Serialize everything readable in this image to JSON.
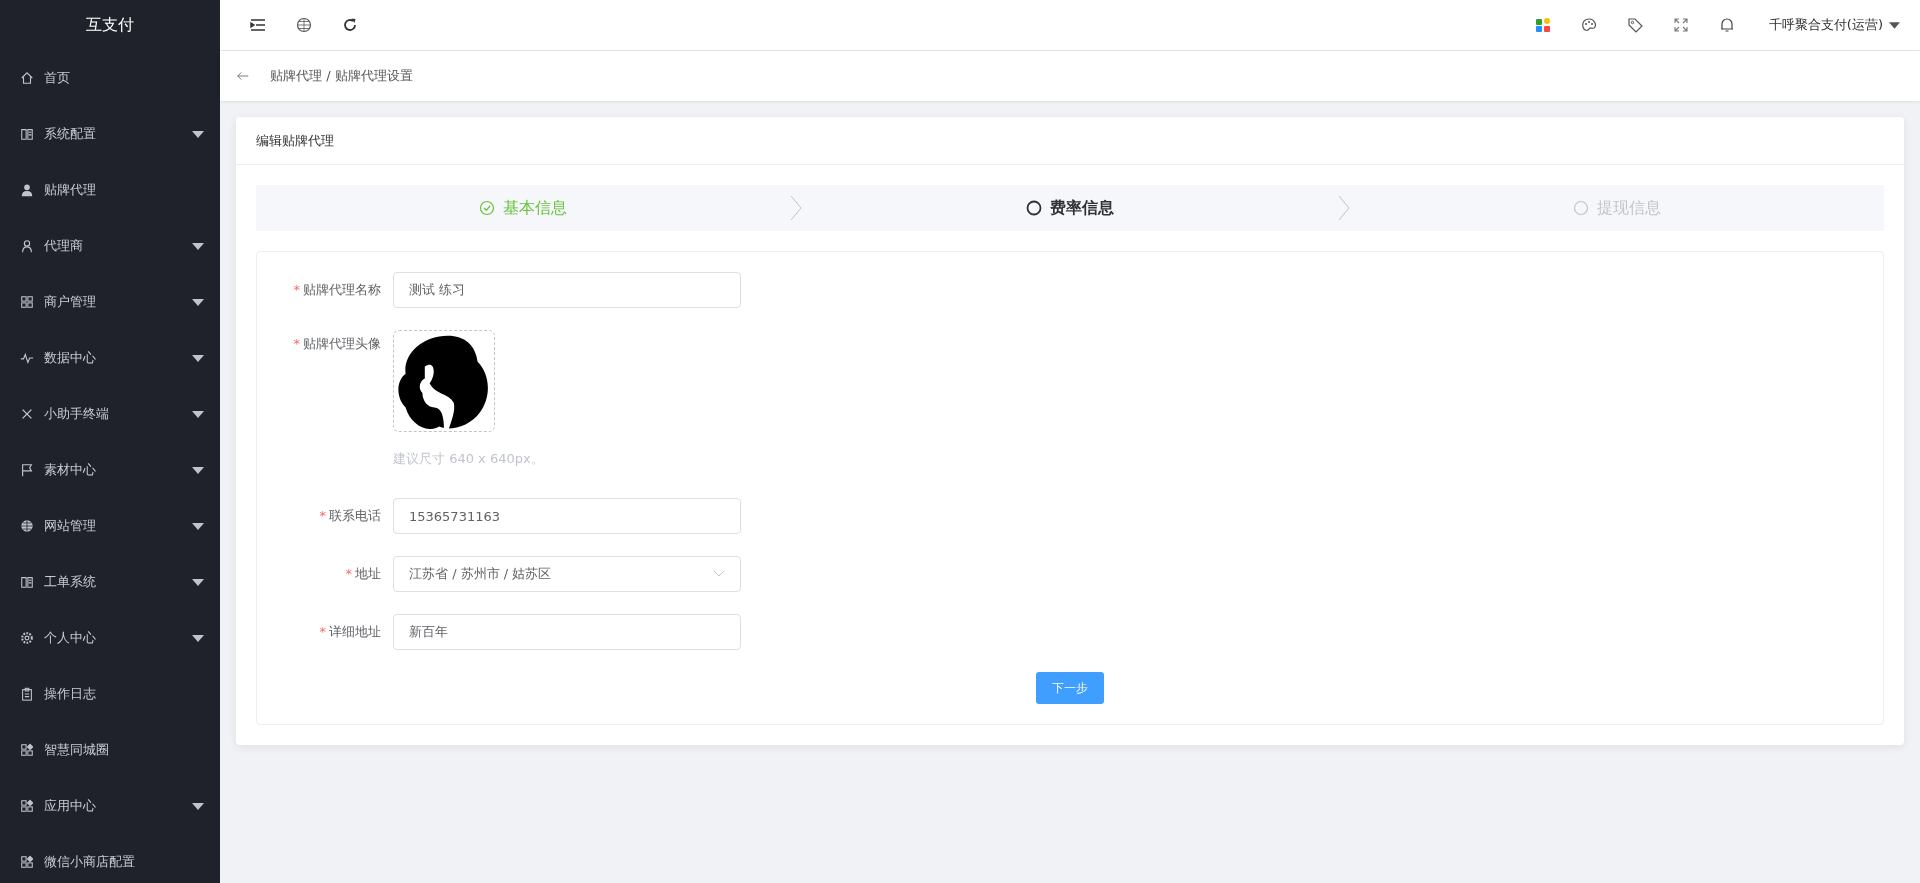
{
  "sidebar": {
    "logo": "互支付",
    "items": [
      {
        "label": "首页",
        "has_submenu": false
      },
      {
        "label": "系统配置",
        "has_submenu": true
      },
      {
        "label": "贴牌代理",
        "has_submenu": false
      },
      {
        "label": "代理商",
        "has_submenu": true
      },
      {
        "label": "商户管理",
        "has_submenu": true
      },
      {
        "label": "数据中心",
        "has_submenu": true
      },
      {
        "label": "小助手终端",
        "has_submenu": true
      },
      {
        "label": "素材中心",
        "has_submenu": true
      },
      {
        "label": "网站管理",
        "has_submenu": true
      },
      {
        "label": "工单系统",
        "has_submenu": true
      },
      {
        "label": "个人中心",
        "has_submenu": true
      },
      {
        "label": "操作日志",
        "has_submenu": false
      },
      {
        "label": "智慧同城圈",
        "has_submenu": false
      },
      {
        "label": "应用中心",
        "has_submenu": true
      },
      {
        "label": "微信小商店配置",
        "has_submenu": false
      }
    ]
  },
  "topbar": {
    "user": "千呼聚合支付(运营)"
  },
  "breadcrumb": "贴牌代理 / 贴牌代理设置",
  "card": {
    "title": "编辑贴牌代理",
    "steps": [
      {
        "label": "基本信息",
        "done": true,
        "selected": false
      },
      {
        "label": "费率信息",
        "done": false,
        "selected": true
      },
      {
        "label": "提现信息",
        "done": false,
        "selected": false
      }
    ],
    "fields": [
      {
        "kind": "input",
        "label": "贴牌代理名称",
        "required_mark": "*",
        "value": "测试 练习"
      },
      {
        "kind": "avatar",
        "label": "贴牌代理头像",
        "required_mark": "*",
        "hint": "建议尺寸 640 x 640px。"
      },
      {
        "kind": "input",
        "label": "联系电话",
        "required_mark": "*",
        "value": "15365731163"
      },
      {
        "kind": "select",
        "label": "地址",
        "required_mark": "*",
        "value": "江苏省 / 苏州市 / 姑苏区"
      },
      {
        "kind": "input",
        "label": "详细地址",
        "required_mark": "*",
        "value": "新百年"
      }
    ],
    "next_button": "下一步"
  }
}
